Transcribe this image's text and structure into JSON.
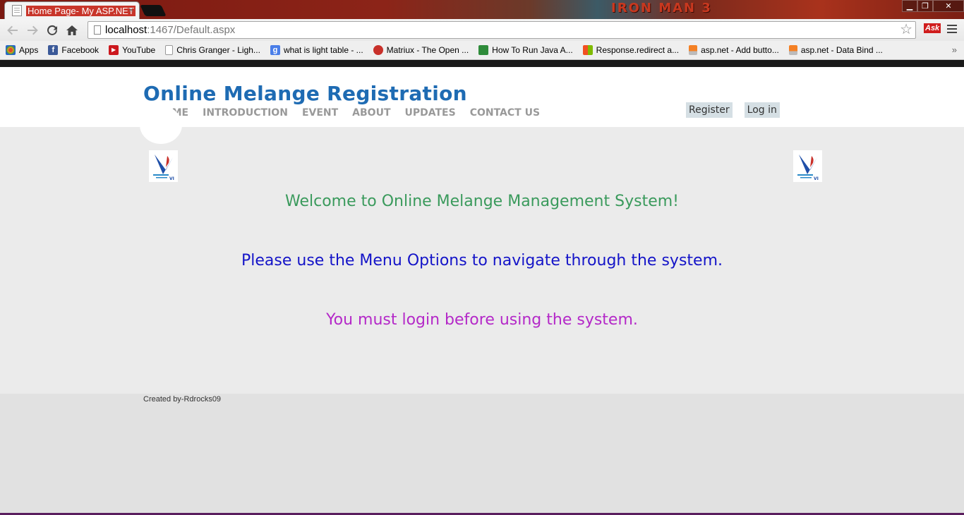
{
  "browser": {
    "tab_title": "Home Page- My ASP.NET",
    "tab_close": "×",
    "banner_text": "IRON MAN 3",
    "window_buttons": {
      "minimize": "▁",
      "restore": "❐",
      "close": "✕"
    },
    "url_host": "localhost",
    "url_path": ":1467/Default.aspx",
    "ask_label": "Ask",
    "bookmarks": [
      {
        "label": "Apps",
        "icon": "apps-grid-icon",
        "color": "#e04a2a"
      },
      {
        "label": "Facebook",
        "icon": "facebook-icon",
        "color": "#3b5998"
      },
      {
        "label": "YouTube",
        "icon": "youtube-icon",
        "color": "#cc181e"
      },
      {
        "label": "Chris Granger - Ligh...",
        "icon": "page-icon",
        "color": "#ffffff"
      },
      {
        "label": "what is light table - ...",
        "icon": "google-icon",
        "color": "#4a7ee8"
      },
      {
        "label": "Matriux - The Open ...",
        "icon": "matriux-icon",
        "color": "#c8302a"
      },
      {
        "label": "How To Run Java A...",
        "icon": "java-icon",
        "color": "#2e8b3a"
      },
      {
        "label": "Response.redirect a...",
        "icon": "microsoft-icon",
        "color": "#f25022"
      },
      {
        "label": "asp.net - Add butto...",
        "icon": "stackoverflow-icon",
        "color": "#f48024"
      },
      {
        "label": "asp.net - Data Bind ...",
        "icon": "stackoverflow-icon",
        "color": "#f48024"
      }
    ],
    "bookmarks_more": "»"
  },
  "site": {
    "title": "Online Melange Registration",
    "nav": [
      "HOME",
      "INTRODUCTION",
      "EVENT",
      "ABOUT",
      "UPDATES",
      "CONTACT US"
    ],
    "register_label": "Register",
    "login_label": "Log in"
  },
  "main": {
    "welcome": "Welcome to Online Melange Management System!",
    "menu_hint": "Please use the Menu Options to navigate through the system.",
    "login_hint": "You must login before using the system."
  },
  "footer": {
    "credit": "Created by-Rdrocks09"
  },
  "colors": {
    "title_blue": "#1e6bb3",
    "welcome_green": "#3a9a5c",
    "menu_blue": "#1414c8",
    "login_purple": "#b429c8"
  }
}
